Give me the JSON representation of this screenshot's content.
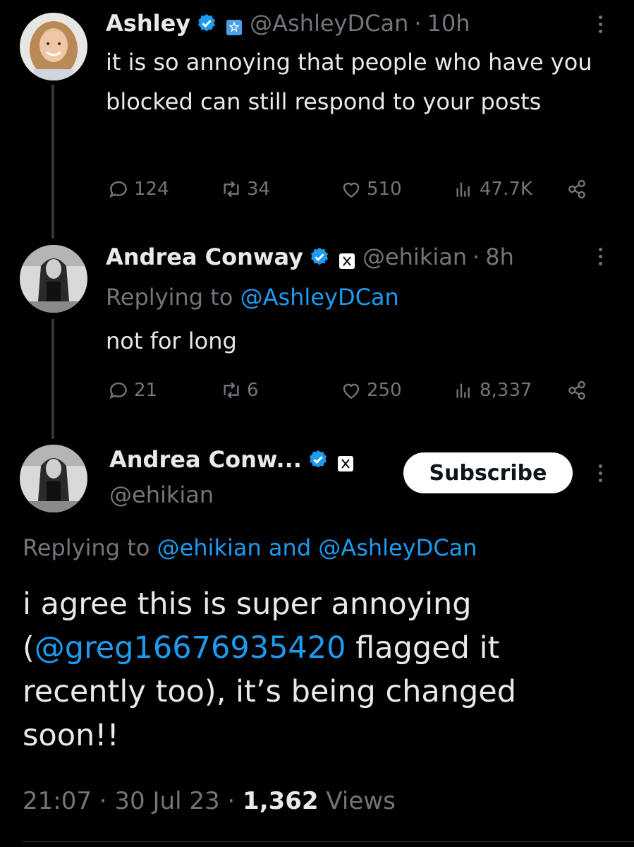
{
  "tweets": [
    {
      "name": "Ashley",
      "handle": "@AshleyDCan",
      "time": "10h",
      "text": "it is so annoying that people who have you blocked can still respond to your posts",
      "stats": {
        "replies": "124",
        "reposts": "34",
        "likes": "510",
        "views": "47.7K"
      }
    },
    {
      "name": "Andrea Conway",
      "handle": "@ehikian",
      "time": "8h",
      "reply_prefix": "Replying to",
      "reply_target": "@AshleyDCan",
      "text": "not for long",
      "stats": {
        "replies": "21",
        "reposts": "6",
        "likes": "250",
        "views": "8,337"
      }
    }
  ],
  "main": {
    "name": "Andrea Conw...",
    "handle": "@ehikian",
    "subscribe_label": "Subscribe",
    "reply_prefix": "Replying to",
    "reply_target_1": "@ehikian",
    "reply_and": "and",
    "reply_target_2": "@AshleyDCan",
    "text_before": "i agree this is super annoying (",
    "mention": "@greg16676935420",
    "text_after": " flagged it recently too), it’s being changed soon!!",
    "time": "21:07",
    "date": "30 Jul 23",
    "views_count": "1,362",
    "views_label": "Views"
  },
  "separator": "·",
  "colors": {
    "background": "#000000",
    "link": "#1d9bf0",
    "verified": "#1d9bf0",
    "muted": "#71767b",
    "text": "#e7e9ea"
  },
  "icons": [
    "reply-icon",
    "repost-icon",
    "like-icon",
    "views-icon",
    "share-icon",
    "verified-icon",
    "more-icon",
    "affiliate-badge-icon",
    "x-logo-icon"
  ]
}
